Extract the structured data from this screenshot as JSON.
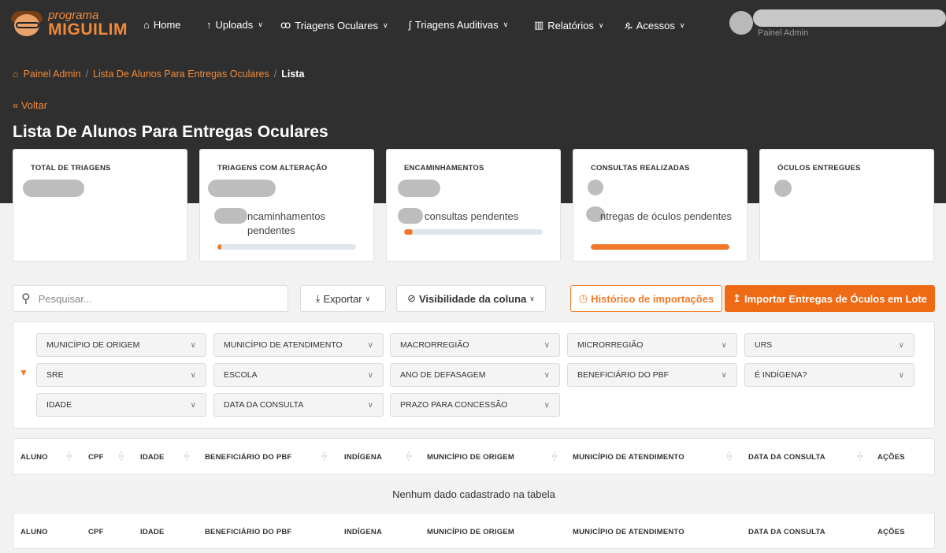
{
  "nav": {
    "logo_line1": "programa",
    "logo_line2": "MIGUILIM",
    "home": "Home",
    "uploads": "Uploads",
    "triagens_oculares": "Triagens Oculares",
    "triagens_auditivas": "Triagens Auditivas",
    "relatorios": "Relatórios",
    "acessos": "Acessos",
    "user_role": "Painel Admin"
  },
  "breadcrumb": {
    "items": [
      "Painel Admin",
      "Lista De Alunos Para Entregas Oculares"
    ],
    "current": "Lista"
  },
  "back_label": "« Voltar",
  "page_title": "Lista De Alunos Para Entregas Oculares",
  "cards": [
    {
      "title": "TOTAL DE TRIAGENS",
      "sub": ""
    },
    {
      "title": "TRIAGENS COM ALTERAÇÃO",
      "sub": "ncaminhamentos pendentes",
      "progress": 0.03
    },
    {
      "title": "ENCAMINHAMENTOS",
      "sub": "consultas pendentes",
      "progress": 0.06
    },
    {
      "title": "CONSULTAS REALIZADAS",
      "sub": "ntregas de óculos pendentes",
      "progress": 1.0
    },
    {
      "title": "ÓCULOS ENTREGUES",
      "sub": ""
    }
  ],
  "toolbar": {
    "search_placeholder": "Pesquisar...",
    "export": "Exportar",
    "column_visibility": "Visibilidade da coluna",
    "import_history": "Histórico de importações",
    "import_batch": "Importar Entregas de Óculos em Lote"
  },
  "filters": [
    "MUNICÍPIO DE ORIGEM",
    "MUNICÍPIO DE ATENDIMENTO",
    "MACRORREGIÃO",
    "MICRORREGIÃO",
    "URS",
    "SRE",
    "ESCOLA",
    "ANO DE DEFASAGEM",
    "BENEFICIÁRIO DO PBF",
    "É INDÍGENA?",
    "IDADE",
    "DATA DA CONSULTA",
    "PRAZO PARA CONCESSÃO"
  ],
  "table": {
    "columns": [
      "ALUNO",
      "CPF",
      "IDADE",
      "BENEFICIÁRIO DO PBF",
      "INDÍGENA",
      "MUNICÍPIO DE ORIGEM",
      "MUNICÍPIO DE ATENDIMENTO",
      "DATA DA CONSULTA",
      "AÇÕES"
    ],
    "empty_message": "Nenhum dado cadastrado na tabela"
  },
  "colors": {
    "accent": "#ee6a15",
    "header_bg": "#2f2f2f"
  }
}
